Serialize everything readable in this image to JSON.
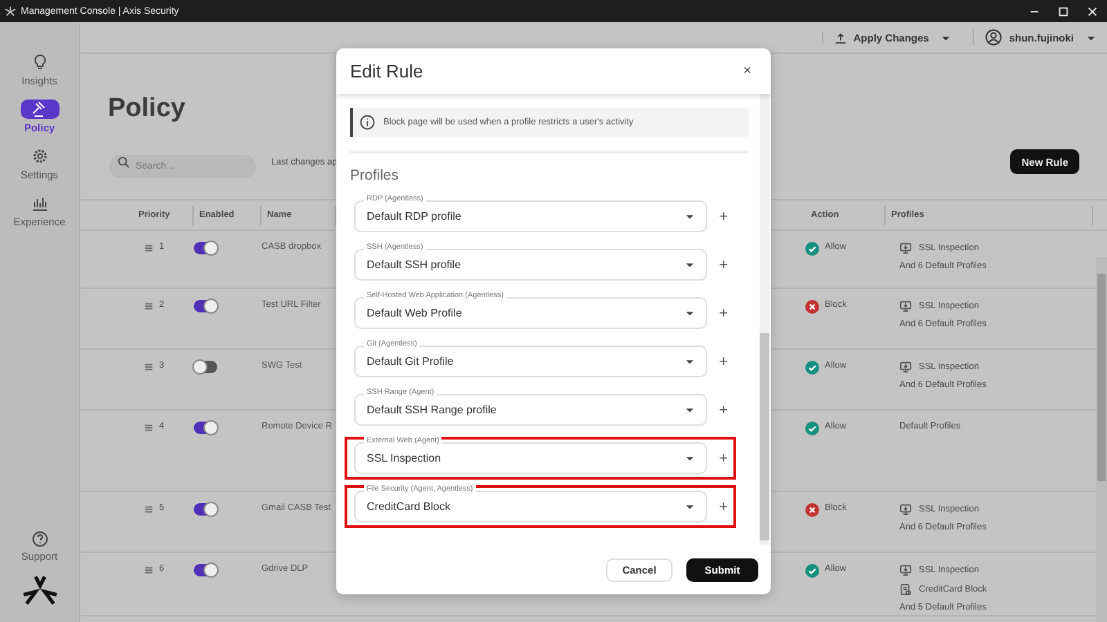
{
  "window": {
    "title": "Management Console | Axis Security"
  },
  "header": {
    "apply_changes": "Apply Changes",
    "user": "shun.fujinoki"
  },
  "sidebar": {
    "items": [
      {
        "label": "Insights",
        "selected": false
      },
      {
        "label": "Policy",
        "selected": true
      },
      {
        "label": "Settings",
        "selected": false
      },
      {
        "label": "Experience",
        "selected": false
      }
    ],
    "support": "Support"
  },
  "page": {
    "title": "Policy",
    "search": {
      "placeholder": "Search..."
    },
    "last_changes": "Last changes ap",
    "new_rule": "New Rule"
  },
  "table": {
    "columns": [
      "Priority",
      "Enabled",
      "Name",
      "Action",
      "Profiles"
    ],
    "rows": [
      {
        "priority": "1",
        "enabled": true,
        "name": "CASB dropbox",
        "action": {
          "kind": "allow",
          "label": "Allow"
        },
        "profiles": [
          {
            "kind": "ssl",
            "text": "SSL Inspection"
          },
          {
            "kind": "plain",
            "text": "And 6 Default Profiles"
          }
        ]
      },
      {
        "priority": "2",
        "enabled": true,
        "name": "Test URL Filter",
        "action": {
          "kind": "block",
          "label": "Block"
        },
        "profiles": [
          {
            "kind": "ssl",
            "text": "SSL Inspection"
          },
          {
            "kind": "plain",
            "text": "And 6 Default Profiles"
          }
        ]
      },
      {
        "priority": "3",
        "enabled": false,
        "name": "SWG Test",
        "action": {
          "kind": "allow",
          "label": "Allow"
        },
        "profiles": [
          {
            "kind": "ssl",
            "text": "SSL Inspection"
          },
          {
            "kind": "plain",
            "text": "And 6 Default Profiles"
          }
        ]
      },
      {
        "priority": "4",
        "enabled": true,
        "name": "Remote Device R",
        "action": {
          "kind": "allow",
          "label": "Allow"
        },
        "profiles": [
          {
            "kind": "plain",
            "text": "Default Profiles"
          }
        ]
      },
      {
        "priority": "5",
        "enabled": true,
        "name": "Gmail CASB Test",
        "action": {
          "kind": "block",
          "label": "Block"
        },
        "profiles": [
          {
            "kind": "ssl",
            "text": "SSL Inspection"
          },
          {
            "kind": "plain",
            "text": "And 6 Default Profiles"
          }
        ]
      },
      {
        "priority": "6",
        "enabled": true,
        "name": "Gdrive DLP",
        "action": {
          "kind": "allow",
          "label": "Allow"
        },
        "profiles": [
          {
            "kind": "ssl",
            "text": "SSL Inspection"
          },
          {
            "kind": "file",
            "text": "CreditCard Block"
          },
          {
            "kind": "plain",
            "text": "And 5 Default Profiles"
          }
        ]
      }
    ]
  },
  "dialog": {
    "title": "Edit Rule",
    "close": "×",
    "info": "Block page will be used when a profile restricts a user's activity",
    "section": "Profiles",
    "fields": [
      {
        "label": "RDP (Agentless)",
        "value": "Default RDP profile",
        "highlighted": false
      },
      {
        "label": "SSH (Agentless)",
        "value": "Default SSH profile",
        "highlighted": false
      },
      {
        "label": "Self-Hosted Web Application (Agentless)",
        "value": "Default Web Profile",
        "highlighted": false
      },
      {
        "label": "Git (Agentless)",
        "value": "Default Git Profile",
        "highlighted": false
      },
      {
        "label": "SSH Range (Agent)",
        "value": "Default SSH Range profile",
        "highlighted": false
      },
      {
        "label": "External Web (Agent)",
        "value": "SSL Inspection",
        "highlighted": true
      },
      {
        "label": "File Security (Agent, Agentless)",
        "value": "CreditCard Block",
        "highlighted": true
      }
    ],
    "add": "+",
    "cancel": "Cancel",
    "submit": "Submit"
  }
}
